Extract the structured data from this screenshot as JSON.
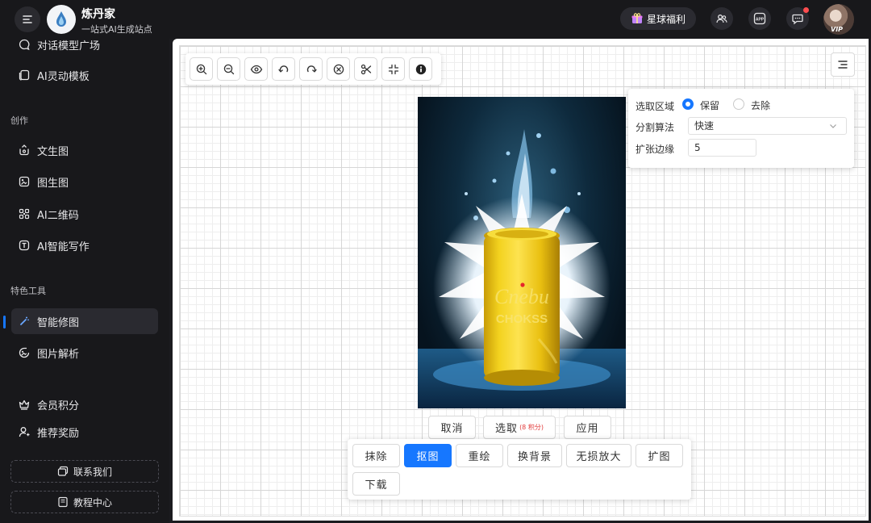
{
  "header": {
    "brand_name": "炼丹家",
    "brand_tagline": "一站式AI生成站点",
    "welfare_label": "星球福利",
    "avatar_badge": "VIP",
    "app_icon_text": "APP"
  },
  "sidebar": {
    "top_items": [
      {
        "label": "对话模型广场",
        "icon": "chat-bubble-icon"
      },
      {
        "label": "AI灵动模板",
        "icon": "template-icon"
      }
    ],
    "section_create": "创作",
    "create_items": [
      {
        "label": "文生图",
        "icon": "text-to-image-icon"
      },
      {
        "label": "图生图",
        "icon": "image-to-image-icon"
      },
      {
        "label": "AI二维码",
        "icon": "qrcode-icon"
      },
      {
        "label": "AI智能写作",
        "icon": "text-icon"
      }
    ],
    "section_tools": "特色工具",
    "tool_items": [
      {
        "label": "智能修图",
        "icon": "magic-wand-icon",
        "active": true
      },
      {
        "label": "图片解析",
        "icon": "image-analyze-icon"
      }
    ],
    "bottom_items": [
      {
        "label": "会员积分",
        "icon": "crown-icon"
      },
      {
        "label": "推荐奖励",
        "icon": "user-icon"
      }
    ],
    "contact_label": "联系我们",
    "tutorial_label": "教程中心"
  },
  "toolbar": {
    "tools": [
      "zoom-in-icon",
      "zoom-out-icon",
      "eye-icon",
      "undo-icon",
      "redo-icon",
      "clear-icon",
      "scissors-icon",
      "shrink-icon",
      "info-icon"
    ]
  },
  "options": {
    "region_label": "选取区域",
    "region_keep": "保留",
    "region_remove": "去除",
    "region_selected": "保留",
    "algo_label": "分割算法",
    "algo_value": "快速",
    "edge_label": "扩张边缘",
    "edge_value": "5"
  },
  "actions": {
    "cancel": "取消",
    "select": "选取",
    "select_points": "(8 积分)",
    "apply": "应用"
  },
  "operations": {
    "erase": "抹除",
    "cutout": "抠图",
    "repaint": "重绘",
    "change_bg": "换背景",
    "upscale": "无损放大",
    "expand": "扩图",
    "download": "下载",
    "active": "抠图"
  },
  "photo": {
    "can_text_1": "Cnebu",
    "can_text_2": "CHOKSS"
  },
  "colors": {
    "accent": "#1677ff",
    "sidebar_bg": "#18181b",
    "points_red": "#e23b3b",
    "notify_red": "#ff4d4f",
    "can_yellow": "#f2cf1d"
  }
}
